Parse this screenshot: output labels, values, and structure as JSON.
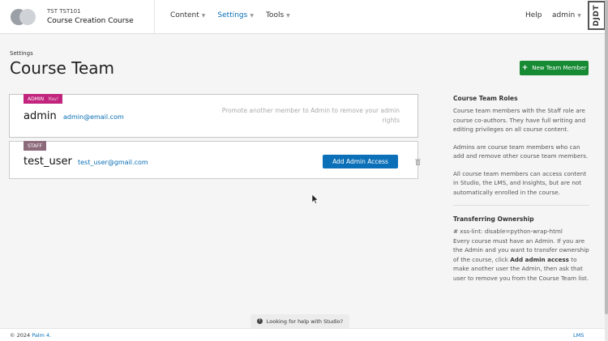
{
  "header": {
    "course_org": "TST TST101",
    "course_title": "Course Creation Course",
    "nav": [
      {
        "label": "Content",
        "active": false
      },
      {
        "label": "Settings",
        "active": true
      },
      {
        "label": "Tools",
        "active": false
      }
    ],
    "help": "Help",
    "user": "admin",
    "djdt": "DJDT"
  },
  "page": {
    "breadcrumb": "Settings",
    "title": "Course Team",
    "new_member_button": "New Team Member"
  },
  "members": [
    {
      "role_badge": "ADMIN",
      "you_label": "You!",
      "name": "admin",
      "email": "admin@email.com",
      "note": "Promote another member to Admin to remove your admin rights"
    },
    {
      "role_badge": "STAFF",
      "name": "test_user",
      "email": "test_user@gmail.com",
      "action_button": "Add Admin Access"
    }
  ],
  "sidebar": {
    "roles_heading": "Course Team Roles",
    "roles_p1": "Course team members with the Staff role are course co-authors. They have full writing and editing privileges on all course content.",
    "roles_p2": "Admins are course team members who can add and remove other course team members.",
    "roles_p3": "All course team members can access content in Studio, the LMS, and Insights, but are not automatically enrolled in the course.",
    "ownership_heading": "Transferring Ownership",
    "ownership_p_lint": "# xss-lint: disable=python-wrap-html",
    "ownership_p_start": "Every course must have an Admin. If you are the Admin and you want to transfer ownership of the course, click ",
    "ownership_p_bold": "Add admin access",
    "ownership_p_end": " to make another user the Admin, then ask that user to remove you from the Course Team list."
  },
  "footer": {
    "help_pill": "Looking for help with Studio?",
    "copyright_prefix": "© 2024",
    "copyright_brand": "Palm 4.",
    "lms_link": "LMS"
  },
  "colors": {
    "accent": "#0a6fb6",
    "new_member_green": "#178a34",
    "admin_badge": "#c2247d",
    "staff_badge": "#8c6a7a"
  }
}
